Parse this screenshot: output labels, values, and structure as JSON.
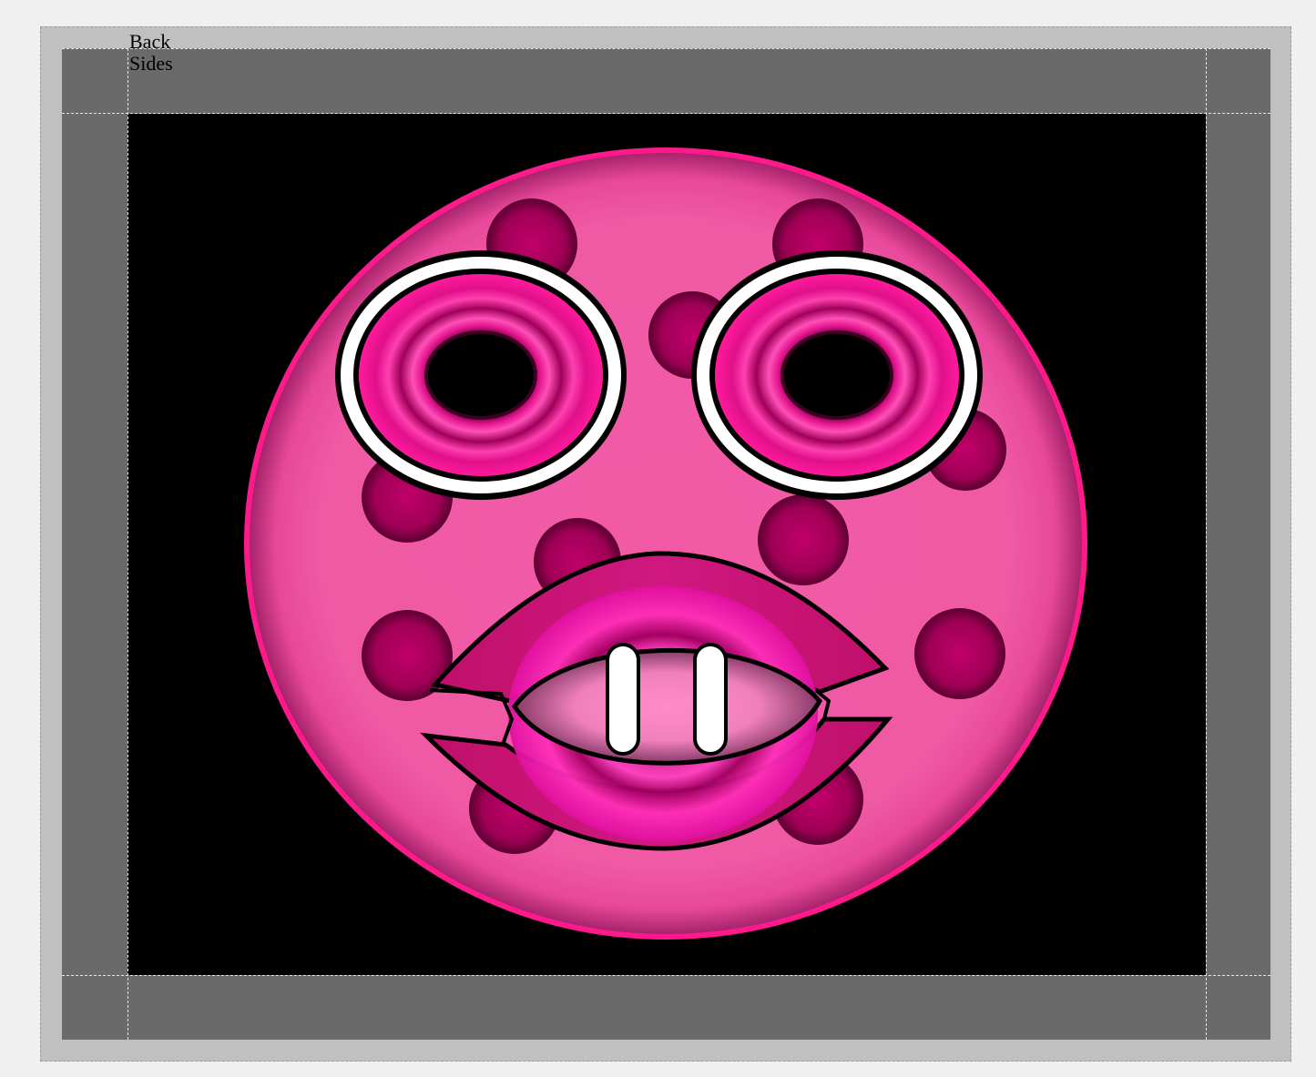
{
  "labels": {
    "back": "Back",
    "sides": "Sides"
  },
  "colors": {
    "page_background": "#f0f0f0",
    "outer_frame": "#c0c0c0",
    "bleed_area": "#6a6a6a",
    "artboard": "#000000",
    "face_pink": "#f05aa5",
    "face_outline": "#ff1a8c",
    "spot": "#b0005a",
    "eye_ring": "#e0108a",
    "teeth": "#ffffff"
  },
  "icons": {
    "face": "pink-spotted-face-illustration"
  }
}
